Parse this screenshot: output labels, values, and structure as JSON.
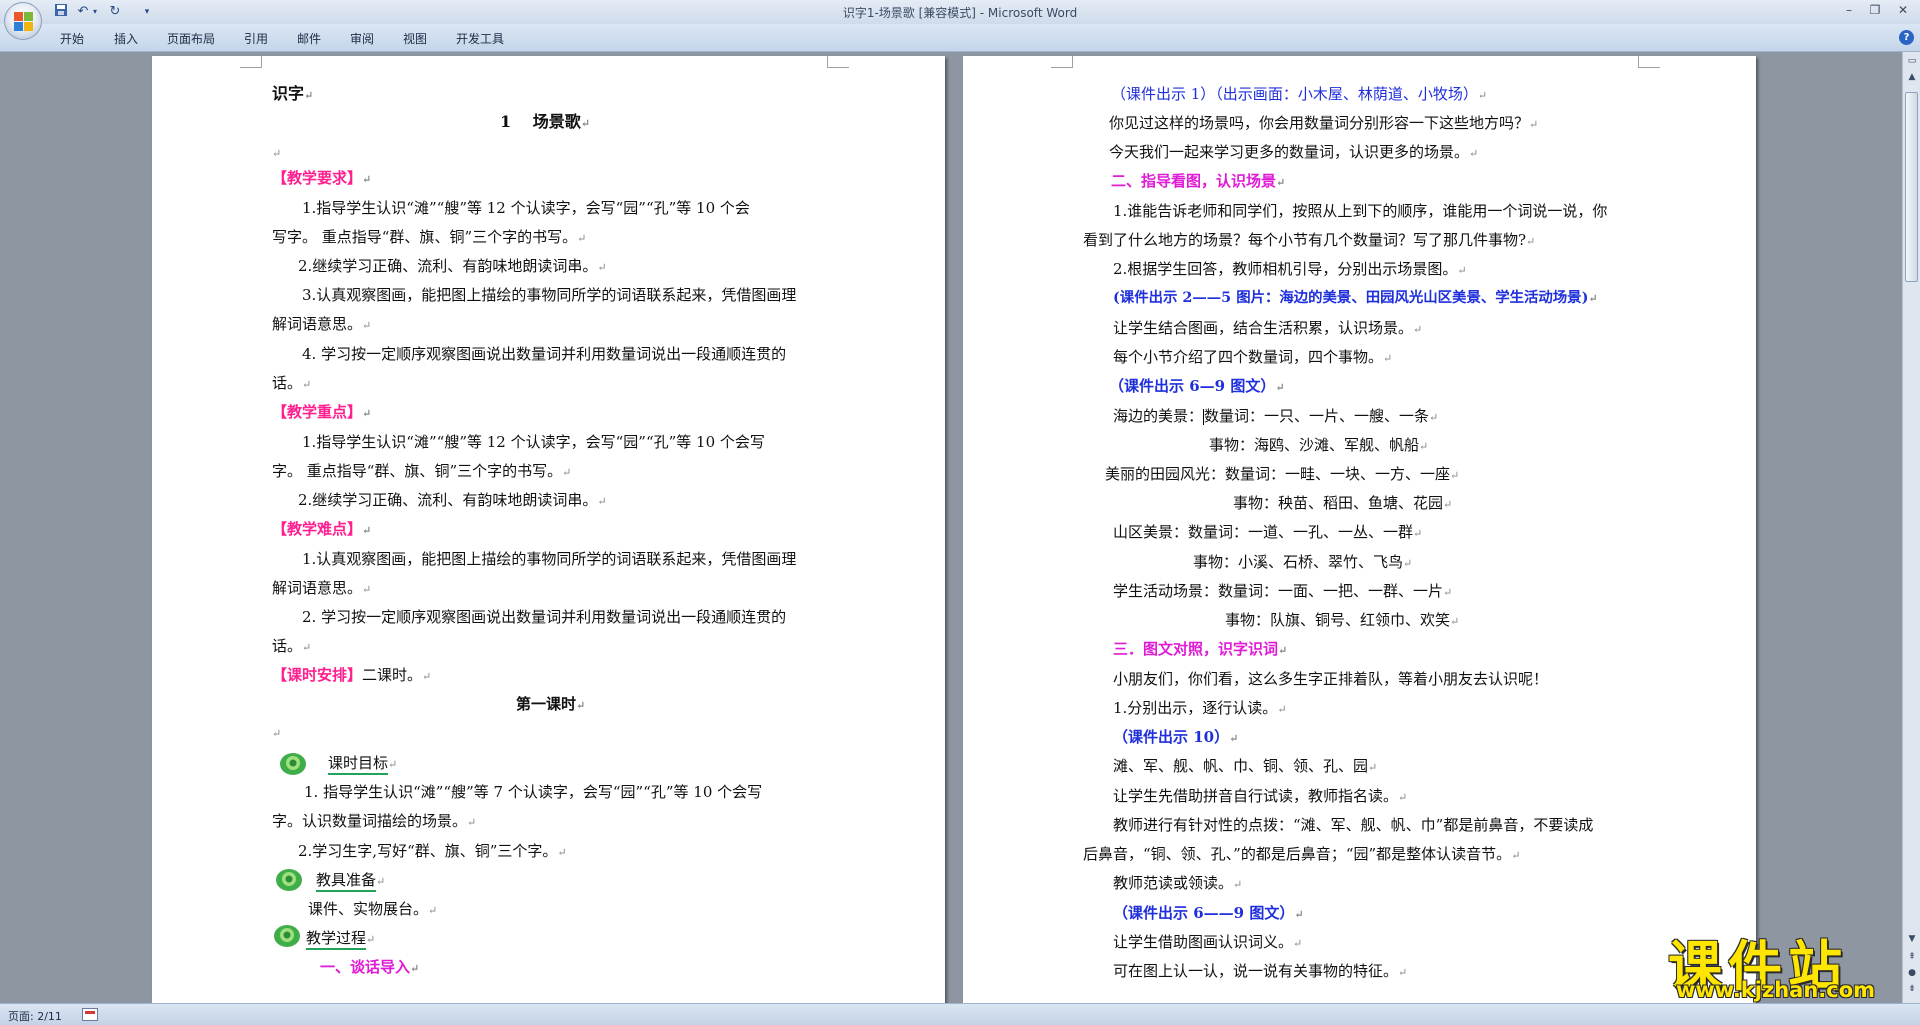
{
  "window": {
    "title": "识字1-场景歌 [兼容模式] - Microsoft Word"
  },
  "quick_access": {
    "save_icon": "save-icon",
    "undo_icon": "undo-icon",
    "redo_icon": "redo-icon",
    "customize_icon": "dropdown-icon"
  },
  "ribbon": {
    "tabs": [
      "开始",
      "插入",
      "页面布局",
      "引用",
      "邮件",
      "审阅",
      "视图",
      "开发工具"
    ],
    "help": "?"
  },
  "left_page": {
    "heading_shizi": "识字",
    "title": "1　 场景歌",
    "req_label": "【教学要求】",
    "req1a": "1.指导学生认识“滩”“艘”等 12 个认读字，会写“园”“孔”等 10 个会",
    "req1b": "写字。 重点指导“群、旗、铜”三个字的书写。",
    "req2": "2.继续学习正确、流利、有韵味地朗读词串。",
    "req3a": "3.认真观察图画，能把图上描绘的事物同所学的词语联系起来，凭借图画理",
    "req3b": "解词语意思。",
    "req4a": "4. 学习按一定顺序观察图画说出数量词并利用数量词说出一段通顺连贯的",
    "req4b": "话。",
    "focus_label": "【教学重点】",
    "focus1a": "1.指导学生认识“滩”“艘”等 12 个认读字，会写“园”“孔”等 10 个会写",
    "focus1b": "字。 重点指导“群、旗、铜”三个字的书写。",
    "focus2": "2.继续学习正确、流利、有韵味地朗读词串。",
    "diff_label": "【教学难点】",
    "diff1a": "1.认真观察图画，能把图上描绘的事物同所学的词语联系起来，凭借图画理",
    "diff1b": "解词语意思。",
    "diff2a": "2. 学习按一定顺序观察图画说出数量词并利用数量词说出一段通顺连贯的",
    "diff2b": "话。",
    "sched_label": "【课时安排】",
    "sched_value": "二课时。",
    "lesson1": "第一课时",
    "goal_title": "课时目标",
    "goal1a": "1. 指导学生认识“滩”“艘”等 7 个认读字，会写“园”“孔”等 10 个会写",
    "goal1b": "字。认识数量词描绘的场景。",
    "goal2": "2.学习生字,写好“群、旗、铜”三个字。",
    "prep_title": "教具准备",
    "prep_value": "课件、实物展台。",
    "process_title": "教学过程",
    "step1": "一、谈话导入"
  },
  "right_page": {
    "r1": "（课件出示 1）（出示画面：小木屋、林荫道、小牧场）",
    "r2": "你见过这样的场景吗，你会用数量词分别形容一下这些地方吗？",
    "r3": "今天我们一起来学习更多的数量词，认识更多的场景。",
    "r4": "二、指导看图，认识场景",
    "r5a": "1.谁能告诉老师和同学们，按照从上到下的顺序，谁能用一个词说一说，你",
    "r5b": "看到了什么地方的场景？每个小节有几个数量词？写了那几件事物?",
    "r6": "2.根据学生回答，教师相机引导，分别出示场景图。",
    "r7": "(课件出示 2——5 图片：海边的美景、田园风光山区美景、学生活动场景)",
    "r8": "让学生结合图画，结合生活积累，认识场景。",
    "r9": "每个小节介绍了四个数量词，四个事物。",
    "r10": "（课件出示 6—9 图文）",
    "sea_label": "海边的美景：",
    "sea_nums": "数量词：一只、一片、一艘、一条",
    "sea_things": "事物：海鸥、沙滩、军舰、帆船",
    "field_nums": "美丽的田园风光：数量词：一畦、一块、一方、一座",
    "field_things": "事物：秧苗、稻田、鱼塘、花园",
    "mountain_nums": "山区美景：数量词：一道、一孔、一丛、一群",
    "mountain_things": "事物：小溪、石桥、翠竹、飞鸟",
    "student_nums": "学生活动场景：数量词：一面、一把、一群、一片",
    "student_things": "事物：队旗、铜号、红领巾、欢笑",
    "r11": "三．图文对照，识字识词",
    "r12": "小朋友们，你们看，这么多生字正排着队，等着小朋友去认识呢！",
    "r13": "1.分别出示，逐行认读。",
    "r14": "（课件出示 10）",
    "r15": "滩、军、舰、帆、巾、铜、领、孔、园",
    "r16": "让学生先借助拼音自行试读，教师指名读。",
    "r17a": "教师进行有针对性的点拨：“滩、军、舰、帆、巾”都是前鼻音，不要读成",
    "r17b": "后鼻音，“铜、领、孔、”的都是后鼻音；“园”都是整体认读音节。",
    "r18": "教师范读或领读。",
    "r19": "（课件出示 6——9 图文）",
    "r20": "让学生借助图画认识词义。",
    "r21": "可在图上认一认，说一说有关事物的特征。"
  },
  "status": {
    "page": "页面: 2/11"
  },
  "watermark": {
    "title": "课件站",
    "url": "www.kjzhan.com"
  },
  "colors": {
    "red_heading": "#ff1f8f",
    "blue_text": "#1f2fdc",
    "magenta_heading": "#e01bd6",
    "watermark_yellow": "#ffe600"
  }
}
